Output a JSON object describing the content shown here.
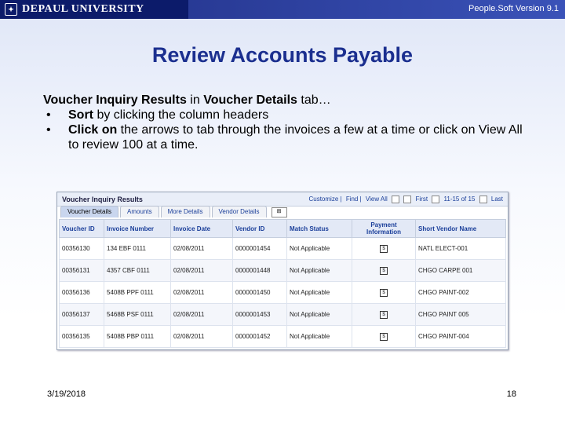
{
  "header": {
    "logo_text": "DEPAUL UNIVERSITY",
    "logo_icon": "seal-icon",
    "version": "People.Soft Version 9.1",
    "colors": {
      "bar": "#2a3c98",
      "logo_box": "#0c1b6a"
    }
  },
  "slide": {
    "title": "Review Accounts Payable",
    "title_color": "#1b2f8f",
    "intro_bold_1": "Voucher Inquiry Results",
    "intro_mid": " in ",
    "intro_bold_2": "Voucher Details",
    "intro_end": " tab…",
    "bullets": [
      {
        "bold": "Sort",
        "text": " by clicking the column headers"
      },
      {
        "bold": "Click on",
        "text": " the arrows to tab through the invoices a few at a time or click on  View All to review 100 at a time."
      }
    ],
    "bullet_char": "•"
  },
  "inquiry": {
    "title": "Voucher Inquiry Results",
    "nav": {
      "customize": "Customize",
      "find": "Find",
      "view_all": "View All",
      "first": "First",
      "range": "11-15 of 15",
      "last": "Last"
    },
    "tabs": [
      "Voucher Details",
      "Amounts",
      "More Details",
      "Vendor Details"
    ],
    "active_tab": "Voucher Details",
    "columns": [
      "Voucher ID",
      "Invoice Number",
      "Invoice Date",
      "Vendor ID",
      "Match Status",
      "Payment Information",
      "Short Vendor Name"
    ],
    "rows": [
      {
        "voucher_id": "00356130",
        "invoice_number": "134 EBF 0111",
        "invoice_date": "02/08/2011",
        "vendor_id": "0000001454",
        "match_status": "Not Applicable",
        "pay_icon": "$",
        "short_vendor_name": "NATL ELECT-001"
      },
      {
        "voucher_id": "00356131",
        "invoice_number": "4357 CBF 0111",
        "invoice_date": "02/08/2011",
        "vendor_id": "0000001448",
        "match_status": "Not Applicable",
        "pay_icon": "$",
        "short_vendor_name": "CHGO CARPE 001"
      },
      {
        "voucher_id": "00356136",
        "invoice_number": "5408B PPF 0111",
        "invoice_date": "02/08/2011",
        "vendor_id": "0000001450",
        "match_status": "Not Applicable",
        "pay_icon": "$",
        "short_vendor_name": "CHGO PAINT-002"
      },
      {
        "voucher_id": "00356137",
        "invoice_number": "5468B PSF 0111",
        "invoice_date": "02/08/2011",
        "vendor_id": "0000001453",
        "match_status": "Not Applicable",
        "pay_icon": "$",
        "short_vendor_name": "CHGO PAINT 005"
      },
      {
        "voucher_id": "00356135",
        "invoice_number": "5408B PBP 0111",
        "invoice_date": "02/08/2011",
        "vendor_id": "0000001452",
        "match_status": "Not Applicable",
        "pay_icon": "$",
        "short_vendor_name": "CHGO PAINT-004"
      }
    ]
  },
  "footer": {
    "date": "3/19/2018",
    "page": "18"
  }
}
